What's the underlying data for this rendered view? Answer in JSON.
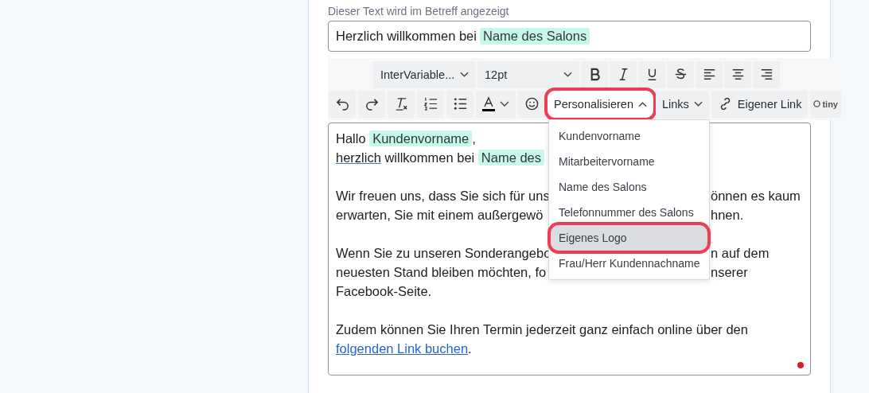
{
  "subject": {
    "label": "Dieser Text wird im Betreff angezeigt",
    "text": "Herzlich willkommen bei",
    "chip": "Name des Salons"
  },
  "toolbar": {
    "font": "InterVariable...",
    "size": "12pt",
    "buttons": [
      {
        "kind": "undo"
      },
      {
        "kind": "redo"
      },
      {
        "kind": "clear"
      },
      {
        "kind": "ol"
      },
      {
        "kind": "ul"
      },
      {
        "kind": "color"
      },
      {
        "kind": "emoji"
      }
    ],
    "menus": [
      {
        "label": "Personalisieren",
        "highlighted": true,
        "expanded": true
      },
      {
        "label": "Links",
        "highlighted": false,
        "expanded": false
      }
    ],
    "link_button": "Eigener Link",
    "brand": "tiny"
  },
  "editor": {
    "lines": [
      {
        "kind": "text",
        "left": [
          {
            "kind": "text",
            "t": "Hallo "
          },
          {
            "kind": "chip",
            "t": "Kundenvorname"
          },
          {
            "kind": "text",
            "t": ","
          }
        ]
      },
      {
        "kind": "text",
        "left": [
          {
            "kind": "spell",
            "t": "herzlich"
          },
          {
            "kind": "text",
            "t": " willkommen bei "
          },
          {
            "kind": "chip",
            "t": "Name des"
          }
        ]
      },
      {
        "kind": "blank"
      },
      {
        "kind": "text",
        "left": [
          {
            "kind": "text",
            "t": "Wir freuen uns, dass Sie sich für uns"
          }
        ],
        "right": "önnen es kaum"
      },
      {
        "kind": "text",
        "left": [
          {
            "kind": "text",
            "t": "erwarten, Sie mit einem außergewö"
          }
        ],
        "right": "hnen."
      },
      {
        "kind": "blank"
      },
      {
        "kind": "text",
        "left": [
          {
            "kind": "text",
            "t": "Wenn Sie zu unseren Sonderangebo"
          }
        ],
        "right": "n auf dem"
      },
      {
        "kind": "text",
        "left": [
          {
            "kind": "text",
            "t": "neuesten Stand bleiben möchten, fo"
          }
        ],
        "right": "nserer"
      },
      {
        "kind": "text",
        "left": [
          {
            "kind": "text",
            "t": "Facebook-Seite."
          }
        ]
      },
      {
        "kind": "blank"
      },
      {
        "kind": "text",
        "left": [
          {
            "kind": "text",
            "t": "Zudem können Sie Ihren Termin jederzeit ganz einfach online über den"
          }
        ]
      },
      {
        "kind": "text",
        "left": [
          {
            "kind": "link",
            "t": "folgenden Link buchen"
          },
          {
            "kind": "text",
            "t": "."
          }
        ]
      }
    ],
    "unsaved": true
  },
  "dropdown": [
    {
      "label": "Kundenvorname",
      "selected": false,
      "highlighted": false
    },
    {
      "label": "Mitarbeitervorname",
      "selected": false,
      "highlighted": false
    },
    {
      "label": "Name des Salons",
      "selected": false,
      "highlighted": false
    },
    {
      "label": "Telefonnummer des Salons",
      "selected": false,
      "highlighted": false
    },
    {
      "label": "Eigenes Logo",
      "selected": true,
      "highlighted": true
    },
    {
      "label": "Frau/Herr Kundennachname",
      "selected": false,
      "highlighted": false
    }
  ]
}
